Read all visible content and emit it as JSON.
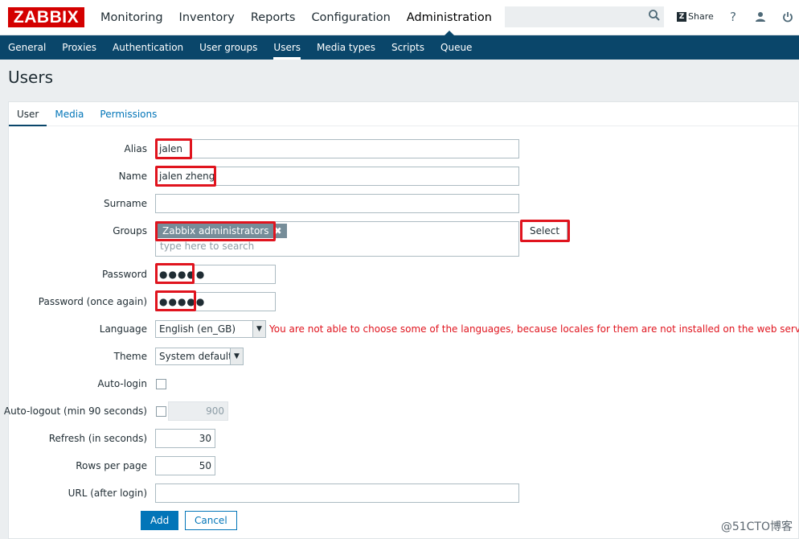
{
  "header": {
    "logo": "ZABBIX",
    "nav": [
      "Monitoring",
      "Inventory",
      "Reports",
      "Configuration",
      "Administration"
    ],
    "active_nav": "Administration",
    "share_label": "Share",
    "help_icon": "?"
  },
  "subnav": {
    "items": [
      "General",
      "Proxies",
      "Authentication",
      "User groups",
      "Users",
      "Media types",
      "Scripts",
      "Queue"
    ],
    "active": "Users"
  },
  "page_title": "Users",
  "tabs": [
    "User",
    "Media",
    "Permissions"
  ],
  "active_tab": "User",
  "form": {
    "alias_label": "Alias",
    "alias_value": "jalen",
    "name_label": "Name",
    "name_value": "jalen zheng",
    "surname_label": "Surname",
    "surname_value": "",
    "groups_label": "Groups",
    "group_tag": "Zabbix administrators",
    "group_remove": "✖",
    "groups_placeholder": "type here to search",
    "select_button": "Select",
    "password_label": "Password",
    "password_value": "●●●●●",
    "password2_label": "Password (once again)",
    "password2_value": "●●●●●",
    "language_label": "Language",
    "language_value": "English (en_GB)",
    "language_warning": "You are not able to choose some of the languages, because locales for them are not installed on the web server.",
    "theme_label": "Theme",
    "theme_value": "System default",
    "autologin_label": "Auto-login",
    "autologout_label": "Auto-logout (min 90 seconds)",
    "autologout_value": "900",
    "refresh_label": "Refresh (in seconds)",
    "refresh_value": "30",
    "rows_label": "Rows per page",
    "rows_value": "50",
    "url_label": "URL (after login)",
    "url_value": "",
    "add_button": "Add",
    "cancel_button": "Cancel"
  },
  "watermark": "@51CTO博客",
  "colors": {
    "brand": "#d40000",
    "nav_bg": "#0a466a",
    "link": "#0275b8",
    "highlight": "#e0141e"
  }
}
